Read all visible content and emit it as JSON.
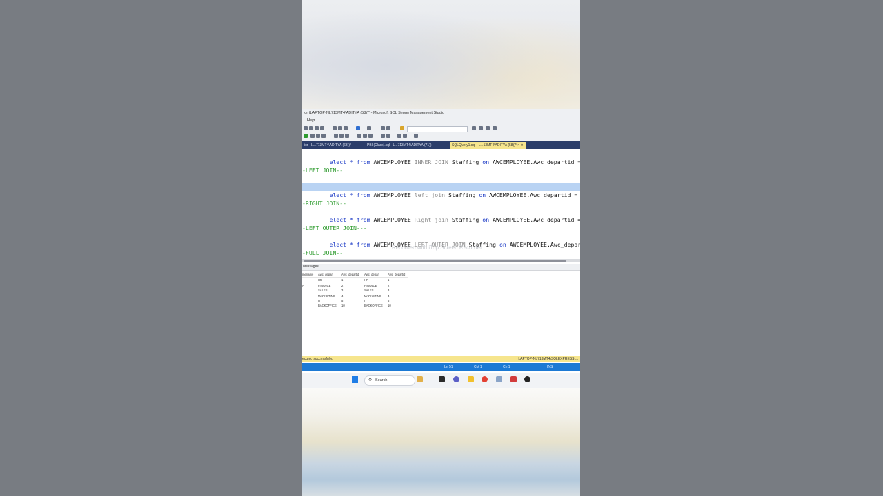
{
  "window": {
    "title": "ior (LAPTOP-NL713MT4\\ADITYA (58))* - Microsoft SQL Server Management Studio"
  },
  "menu": [
    "Help"
  ],
  "tabs": [
    {
      "label": "ior - L...713MT4\\ADITYA (63))*",
      "active": false
    },
    {
      "label": "PBI (Class).sql - L...713MT4\\ADITYA (71))",
      "active": false
    },
    {
      "label": "SQLQuery1.sql - L...13MT4\\ADITYA (58))*",
      "active": true,
      "close": "× ✕"
    }
  ],
  "code": {
    "line1": {
      "kw1": "elect * ",
      "kw2": "from",
      "t1": " AWCEMPLOYEE ",
      "g1": "INNER JOIN",
      "t2": " Staffing ",
      "kw3": "on",
      "t3": " AWCEMPLOYEE.Awc_departid = Staffi"
    },
    "comment_left": "-LEFT JOIN--",
    "line2": {
      "kw1": "elect * ",
      "kw2": "from",
      "t1": " AWCEMPLOYEE ",
      "g1": "left join",
      "t2": " Staffing ",
      "kw3": "on",
      "t3": " AWCEMPLOYEE.Awc_departid = Staffin"
    },
    "comment_right": "-RIGHT JOIN--",
    "line3": {
      "kw1": "elect * ",
      "kw2": "from",
      "t1": " AWCEMPLOYEE ",
      "g1": "Right join",
      "t2": " Staffing ",
      "kw3": "on",
      "t3": " AWCEMPLOYEE.Awc_departid = Staffi"
    },
    "comment_leftouter": "-LEFT OUTER JOIN---",
    "line4": {
      "kw1": "elect * ",
      "kw2": "from",
      "t1": " AWCEMPLOYEE ",
      "g1": "LEFT OUTER JOIN",
      "t2": " Staffing ",
      "kw3": "on",
      "t3": " AWCEMPLOYEE.Awc_departid = S"
    },
    "comment_full": "-FULL JOIN--"
  },
  "watermark": "Recorded with iTop Screen Recorder",
  "results": {
    "tab_label": "Messages",
    "columns": [
      "mename",
      "Awc_depart",
      "Awc_departid",
      "Awc_depart",
      "Awc_departid"
    ],
    "rows": [
      [
        "",
        "HR",
        "1",
        "HR",
        "1"
      ],
      [
        "A",
        "FINANCE",
        "2",
        "FINANCE",
        "2"
      ],
      [
        "",
        "SALES",
        "3",
        "SALES",
        "3"
      ],
      [
        "",
        "MARKETING",
        "4",
        "MARKETING",
        "4"
      ],
      [
        "",
        "IT",
        "5",
        "IT",
        "5"
      ],
      [
        "",
        "BACKOFFICE",
        "10",
        "BACKOFFICE",
        "10"
      ]
    ]
  },
  "status": {
    "message": "ecuted successfully.",
    "server": "LAPTOP-NL713MT4\\SQLEXPRESS ..."
  },
  "position": {
    "ln": "Ln 51",
    "col": "Col 1",
    "ch": "Ch 1",
    "mode": "INS"
  },
  "taskbar": {
    "search_label": "Search"
  },
  "colors": {
    "accent_tab_bar": "#2b3d6a",
    "active_tab": "#f6e58d",
    "status_bar": "#f6e58d",
    "position_bar": "#1c79d4",
    "keyword": "#1a39c6",
    "comment": "#2e9b2e",
    "selection": "#b9d3f3"
  }
}
